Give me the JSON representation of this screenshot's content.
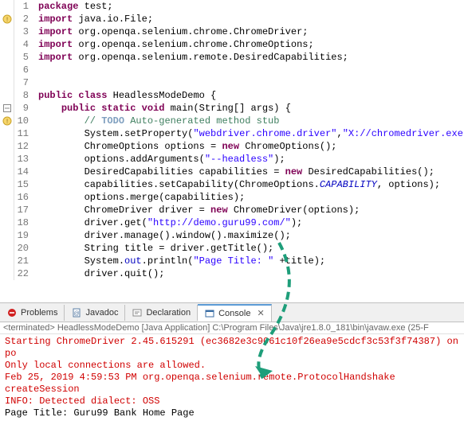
{
  "code": {
    "lines": [
      {
        "n": "1",
        "gutter": "",
        "html": "<span class='kw'>package</span> test;"
      },
      {
        "n": "2",
        "gutter": "warn-import",
        "html": "<span class='kw'>import</span> java.io.File;"
      },
      {
        "n": "3",
        "gutter": "",
        "html": "<span class='kw'>import</span> org.openqa.selenium.chrome.ChromeDriver;"
      },
      {
        "n": "4",
        "gutter": "",
        "html": "<span class='kw'>import</span> org.openqa.selenium.chrome.ChromeOptions;"
      },
      {
        "n": "5",
        "gutter": "",
        "html": "<span class='kw'>import</span> org.openqa.selenium.remote.DesiredCapabilities;"
      },
      {
        "n": "6",
        "gutter": "",
        "html": ""
      },
      {
        "n": "7",
        "gutter": "",
        "html": ""
      },
      {
        "n": "8",
        "gutter": "",
        "html": "<span class='kw'>public</span> <span class='kw'>class</span> HeadlessModeDemo {"
      },
      {
        "n": "9",
        "gutter": "collapse",
        "html": "    <span class='kw'>public</span> <span class='kw'>static</span> <span class='kw'>void</span> main(String[] args) {"
      },
      {
        "n": "10",
        "gutter": "warn",
        "html": "        <span class='com'>// </span><span class='todo'>TODO</span><span class='com'> Auto-generated method stub</span>"
      },
      {
        "n": "11",
        "gutter": "",
        "html": "        System.<span class='type'>setProperty</span>(<span class='str'>\"webdriver.chrome.driver\"</span>,<span class='str'>\"X://chromedriver.exe\"</span>);"
      },
      {
        "n": "12",
        "gutter": "",
        "html": "        ChromeOptions options = <span class='kw'>new</span> ChromeOptions();"
      },
      {
        "n": "13",
        "gutter": "",
        "html": "        options.addArguments(<span class='str'>\"--headless\"</span>);"
      },
      {
        "n": "14",
        "gutter": "",
        "html": "        DesiredCapabilities capabilities = <span class='kw'>new</span> DesiredCapabilities();"
      },
      {
        "n": "15",
        "gutter": "",
        "html": "        capabilities.setCapability(ChromeOptions.<span class='staticfield'>CAPABILITY</span>, options);"
      },
      {
        "n": "16",
        "gutter": "",
        "html": "        options.merge(capabilities);"
      },
      {
        "n": "17",
        "gutter": "",
        "html": "        ChromeDriver driver = <span class='kw'>new</span> ChromeDriver(options);"
      },
      {
        "n": "18",
        "gutter": "",
        "html": "        driver.get(<span class='str'>\"http://demo.guru99.com/\"</span>);"
      },
      {
        "n": "19",
        "gutter": "",
        "html": "        driver.manage().window().maximize();"
      },
      {
        "n": "20",
        "gutter": "",
        "html": "        String title = driver.getTitle();"
      },
      {
        "n": "21",
        "gutter": "",
        "html": "        System.<span class='field'>out</span>.println(<span class='str'>\"Page Title: \"</span> +title);"
      },
      {
        "n": "22",
        "gutter": "",
        "html": "        driver.quit();"
      }
    ]
  },
  "tabs": {
    "problems": "Problems",
    "javadoc": "Javadoc",
    "declaration": "Declaration",
    "console": "Console"
  },
  "console": {
    "header": "<terminated> HeadlessModeDemo [Java Application] C:\\Program Files\\Java\\jre1.8.0_181\\bin\\javaw.exe (25-F",
    "l1": "Starting ChromeDriver 2.45.615291 (ec3682e3c9061c10f26ea9e5cdcf3c53f3f74387) on po",
    "l2": "Only local connections are allowed.",
    "l3": "Feb 25, 2019 4:59:53 PM org.openqa.selenium.remote.ProtocolHandshake createSession",
    "l4": "INFO: Detected dialect: OSS",
    "l5": "Page Title: Guru99 Bank Home Page"
  }
}
